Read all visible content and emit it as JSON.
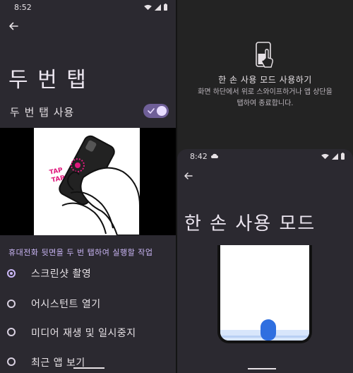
{
  "left_screen": {
    "status_bar": {
      "time": "8:52"
    },
    "title": "두 번 탭",
    "toggle": {
      "label": "두 번 탭 사용",
      "enabled": true
    },
    "illustration": {
      "icon": "phone-double-tap-illustration",
      "tap_text_1": "TAP",
      "tap_text_2": "TAP"
    },
    "section_header": "휴대전화 뒷면을 두 번 탭하여 실행할 작업",
    "options": [
      {
        "label": "스크린샷 촬영",
        "selected": true
      },
      {
        "label": "어시스턴트 열기",
        "selected": false
      },
      {
        "label": "미디어 재생 및 일시중지",
        "selected": false
      },
      {
        "label": "최근 앱 보기",
        "selected": false
      }
    ]
  },
  "right_screen": {
    "one_handed_prompt": {
      "icon": "one-handed-gesture-icon",
      "title": "한 손 사용 모드 사용하기",
      "description_line_1": "화면 하단에서 위로 스와이프하거나 앱 상단을",
      "description_line_2": "탭하여 종료합니다."
    },
    "inner_screen": {
      "status_bar": {
        "time": "8:42"
      },
      "title": "한 손 사용 모드"
    }
  },
  "colors": {
    "panel_bg": "#2b2930",
    "accent": "#cbb8f7",
    "switch_track": "#6f5f98",
    "preview_handle": "#2f6fe0",
    "tap_magenta": "#e0197d"
  }
}
